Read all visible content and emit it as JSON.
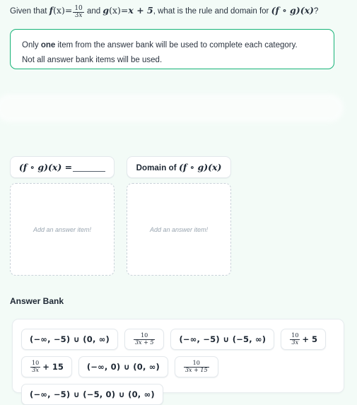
{
  "prompt": {
    "lead": "Given that ",
    "f_name": "f",
    "f_var": "(x)",
    "f_eq": "=",
    "f_num": "10",
    "f_den_coef": "3",
    "f_den_var": "x",
    "and": " and ",
    "g_name": "g",
    "g_var": "(x)",
    "g_eq": "=",
    "g_expr": "x + 5",
    "tail": ", what is the rule and domain for ",
    "comp": "(f ∘ g)(x)",
    "question_mark": "?"
  },
  "callout": {
    "line1_pre": "Only ",
    "line1_bold": "one",
    "line1_post": " item from the answer bank will be used to complete each category.",
    "line2": "Not all answer bank items will be used.",
    "border_color": "#16b377"
  },
  "categories": [
    {
      "id": "rule",
      "header_prefix": "(f ∘ g)(x) =",
      "header_has_blank": true,
      "placeholder": "Add an answer item!",
      "items": []
    },
    {
      "id": "domain",
      "header_bold_lead": "Domain of ",
      "header_suffix": "(f ∘ g)(x)",
      "header_has_blank": false,
      "placeholder": "Add an answer item!",
      "items": []
    }
  ],
  "answer_bank": {
    "title": "Answer Bank",
    "items": [
      {
        "id": "c1",
        "kind": "interval",
        "text": "(−∞, −5) ∪ (0, ∞)"
      },
      {
        "id": "c2",
        "kind": "fraction",
        "num": "10",
        "den": "3x + 5"
      },
      {
        "id": "c3",
        "kind": "interval",
        "text": "(−∞, −5) ∪ (−5, ∞)"
      },
      {
        "id": "c4",
        "kind": "fraction_plus",
        "num": "10",
        "den": "3x",
        "plus": "+ 5"
      },
      {
        "id": "c5",
        "kind": "fraction_plus",
        "num": "10",
        "den": "3x",
        "plus": "+ 15"
      },
      {
        "id": "c6",
        "kind": "interval",
        "text": "(−∞, 0) ∪ (0, ∞)"
      },
      {
        "id": "c7",
        "kind": "fraction",
        "num": "10",
        "den": "3x + 15"
      },
      {
        "id": "c8",
        "kind": "interval",
        "text": "(−∞, −5) ∪ (−5, 0) ∪ (0, ∞)"
      }
    ]
  },
  "theme": {
    "page_background": "#f3fbf7",
    "card_background": "#ffffff",
    "text_color": "#1d2733",
    "muted_text": "#9aa6b1",
    "border_color": "#e3e8ec",
    "accent_green": "#16b377"
  }
}
